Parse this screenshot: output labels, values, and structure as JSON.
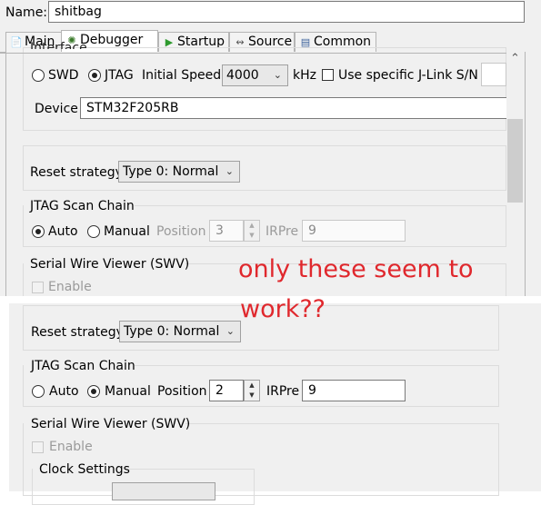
{
  "header": {
    "name_label": "Name:",
    "name_value": "shitbag"
  },
  "tabs": [
    {
      "label": "Main",
      "icon": "document-icon"
    },
    {
      "label": "Debugger",
      "icon": "bug-icon"
    },
    {
      "label": "Startup",
      "icon": "play-icon"
    },
    {
      "label": "Source",
      "icon": "source-icon"
    },
    {
      "label": "Common",
      "icon": "window-icon"
    }
  ],
  "panel1": {
    "interface_label": "Interface",
    "swd_label": "SWD",
    "jtag_label": "JTAG",
    "initial_speed_label": "Initial Speed",
    "initial_speed_value": "4000",
    "khz_label": "kHz",
    "specific_sn_label": "Use specific J-Link S/N",
    "device_label": "Device",
    "device_value": "STM32F205RB",
    "reset_label": "Reset strategy",
    "reset_value": "Type 0: Normal",
    "jtag_chain_title": "JTAG Scan Chain",
    "auto_label": "Auto",
    "manual_label": "Manual",
    "position_label": "Position",
    "position_value": "3",
    "irpre_label": "IRPre",
    "irpre_value": "9",
    "swv_title": "Serial Wire Viewer (SWV)",
    "enable_label": "Enable"
  },
  "annotation": {
    "line1": "only these seem to",
    "line2": "work??",
    "color": "#e0282d"
  },
  "panel2": {
    "reset_label": "Reset strategy",
    "reset_value": "Type 0: Normal",
    "jtag_chain_title": "JTAG Scan Chain",
    "auto_label": "Auto",
    "manual_label": "Manual",
    "position_label": "Position",
    "position_value": "2",
    "irpre_label": "IRPre",
    "irpre_value": "9",
    "swv_title": "Serial Wire Viewer (SWV)",
    "enable_label": "Enable",
    "clock_title": "Clock Settings"
  }
}
